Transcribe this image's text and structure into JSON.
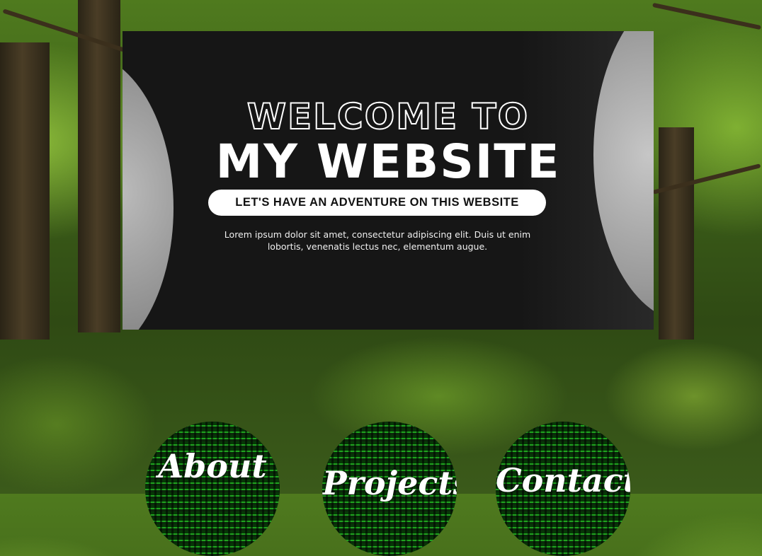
{
  "banner": {
    "line1": "WELCOME TO",
    "line2": "MY WEBSITE",
    "tagline": "LET'S HAVE AN ADVENTURE ON THIS WEBSITE",
    "body": "Lorem ipsum dolor sit amet, consectetur adipiscing elit. Duis ut enim lobortis, venenatis lectus nec, elementum augue."
  },
  "nav": {
    "about_label": "About",
    "projects_label": "Projects",
    "contacts_label": "Contacts"
  }
}
